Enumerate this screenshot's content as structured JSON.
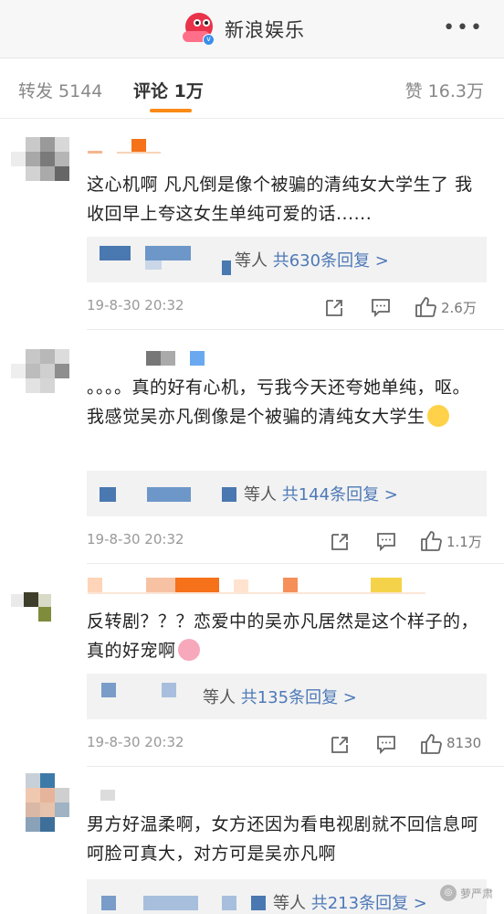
{
  "header": {
    "account_name": "新浪娱乐",
    "logo_text": "新浪娱乐",
    "more_icon": "more-horizontal-icon"
  },
  "tabs": {
    "forward_label": "转发 5144",
    "comment_label": "评论 1万",
    "like_label": "赞 16.3万",
    "active_color": "#fa8b16"
  },
  "comments": [
    {
      "text": "这心机啊 凡凡倒是像个被骗的清纯女大学生了 我收回早上夸这女生单纯可爱的话......",
      "reply_prefix": "等人",
      "reply_link": "共630条回复 >",
      "timestamp": "19-8-30 20:32",
      "likes": "2.6万"
    },
    {
      "text": "。。。。真的好有心机，亏我今天还夸她单纯，呕。 我感觉吴亦凡倒像是个被骗的清纯女大学生",
      "emoji": "grinning-tears-emoji",
      "reply_prefix": "等人",
      "reply_link": "共144条回复 >",
      "timestamp": "19-8-30 20:32",
      "likes": "1.1万"
    },
    {
      "text": "反转剧？？？恋爱中的吴亦凡居然是这个样子的，真的好宠啊",
      "emoji": "pig-emoji",
      "reply_prefix": "等人",
      "reply_link": "共135条回复 >",
      "timestamp": "19-8-30 20:32",
      "likes": "8130"
    },
    {
      "text": "男方好温柔啊，女方还因为看电视剧就不回信息呵呵脸可真大，对方可是吴亦凡啊",
      "reply_prefix": "等人",
      "reply_link": "共213条回复 >"
    }
  ],
  "watermark": "萝严肃",
  "colors": {
    "link": "#4d79b8",
    "reply_bg": "#f2f2f2",
    "brand_red": "#e8334a"
  }
}
